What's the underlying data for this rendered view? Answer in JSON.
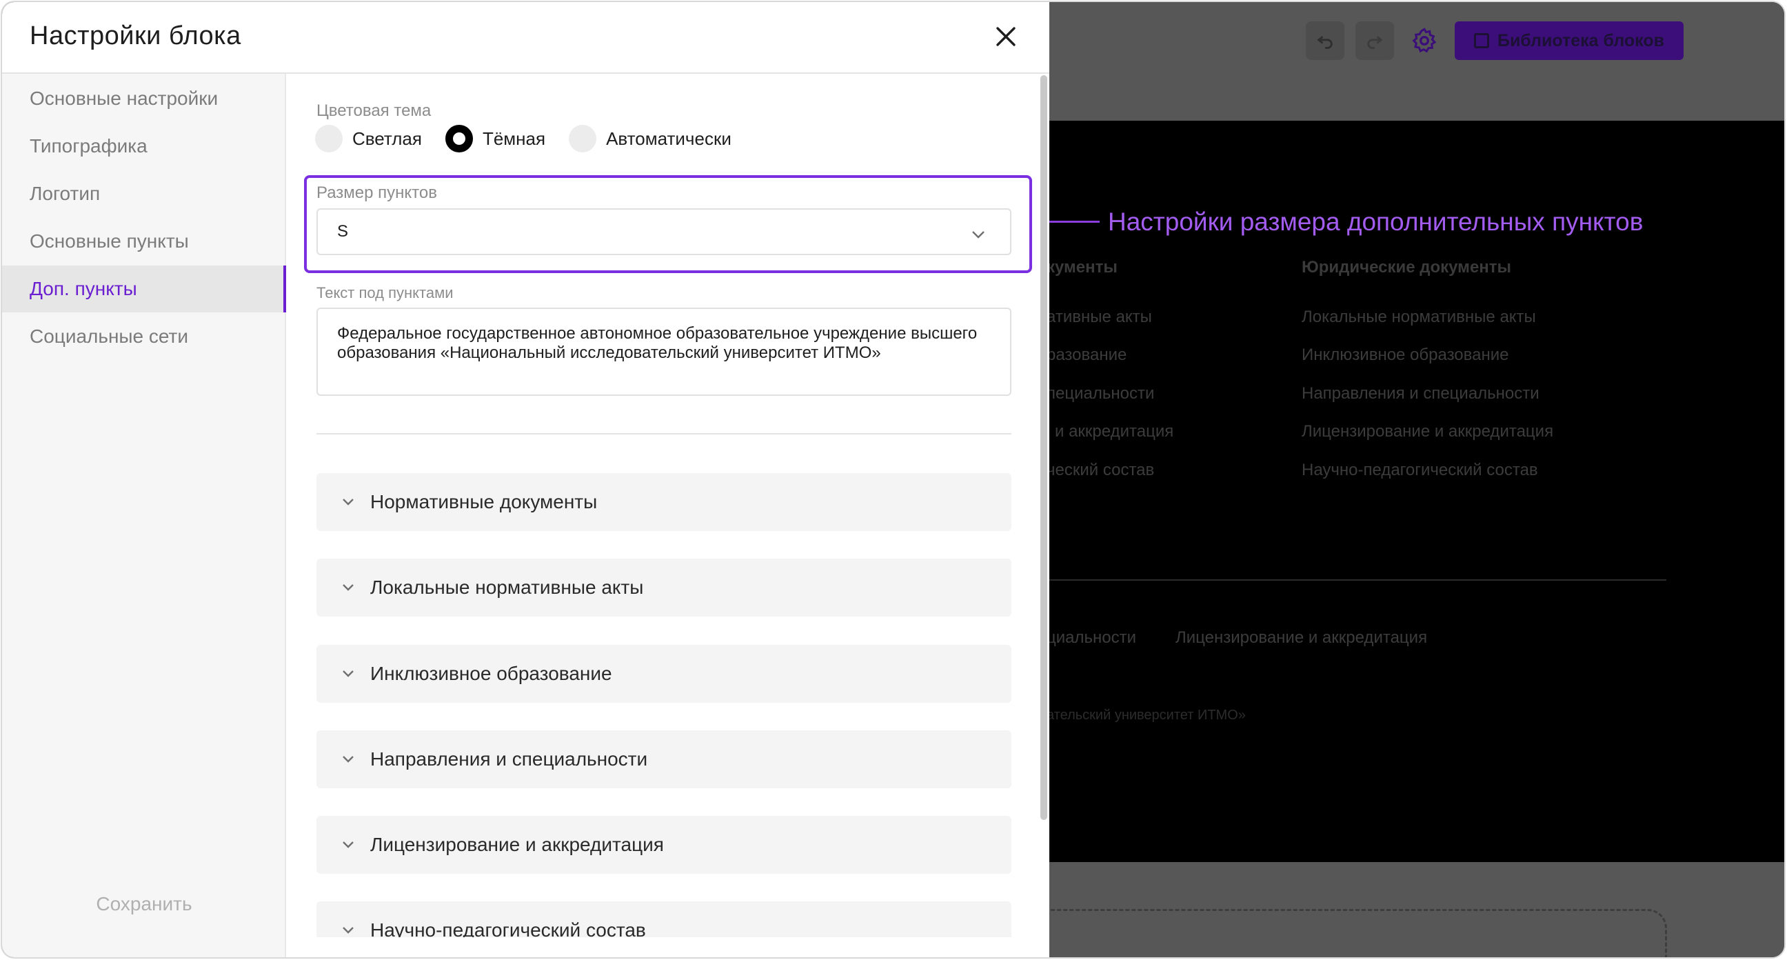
{
  "modal": {
    "title": "Настройки блока",
    "save_label": "Сохранить"
  },
  "sidebar": {
    "items": [
      {
        "label": "Основные настройки"
      },
      {
        "label": "Типографика"
      },
      {
        "label": "Логотип"
      },
      {
        "label": "Основные пункты"
      },
      {
        "label": "Доп. пункты"
      },
      {
        "label": "Социальные сети"
      }
    ],
    "active": "Доп. пункты"
  },
  "theme": {
    "label": "Цветовая тема",
    "options": [
      {
        "label": "Светлая"
      },
      {
        "label": "Тёмная"
      },
      {
        "label": "Автоматически"
      }
    ],
    "selected": "Тёмная"
  },
  "item_size": {
    "label": "Размер пунктов",
    "value": "S"
  },
  "text_below": {
    "label": "Текст под пунктами",
    "value": "Федеральное государственное автономное образовательное учреждение высшего образования «Национальный исследовательский университет ИТМО»"
  },
  "accordion": [
    {
      "label": "Нормативные документы"
    },
    {
      "label": "Локальные нормативные акты"
    },
    {
      "label": "Инклюзивное образование"
    },
    {
      "label": "Направления и специальности"
    },
    {
      "label": "Лицензирование и аккредитация"
    },
    {
      "label": "Научно-педагогический состав"
    }
  ],
  "callout": {
    "text": "Настройки размера дополнительных пунктов"
  },
  "editor": {
    "library_button": "Библиотека блоков",
    "col1_title": "кументы",
    "col1_links": [
      "ативные акты",
      "разование",
      "пециальности",
      "и аккредитация",
      "ческий состав"
    ],
    "col2_title": "Юридические документы",
    "col2_links": [
      "Локальные нормативные акты",
      "Инклюзивное образование",
      "Направления и специальности",
      "Лицензирование и аккредитация",
      "Научно-педагогический состав"
    ],
    "bottom_link_1": "циальности",
    "bottom_link_2": "Лицензирование и аккредитация",
    "copyright_fragment": "ательский университет ИТМО»"
  },
  "colors": {
    "accent": "#6a1fd0",
    "highlight_border": "#7a2fe0",
    "callout": "#a35cf0",
    "overlay": "#575757"
  }
}
